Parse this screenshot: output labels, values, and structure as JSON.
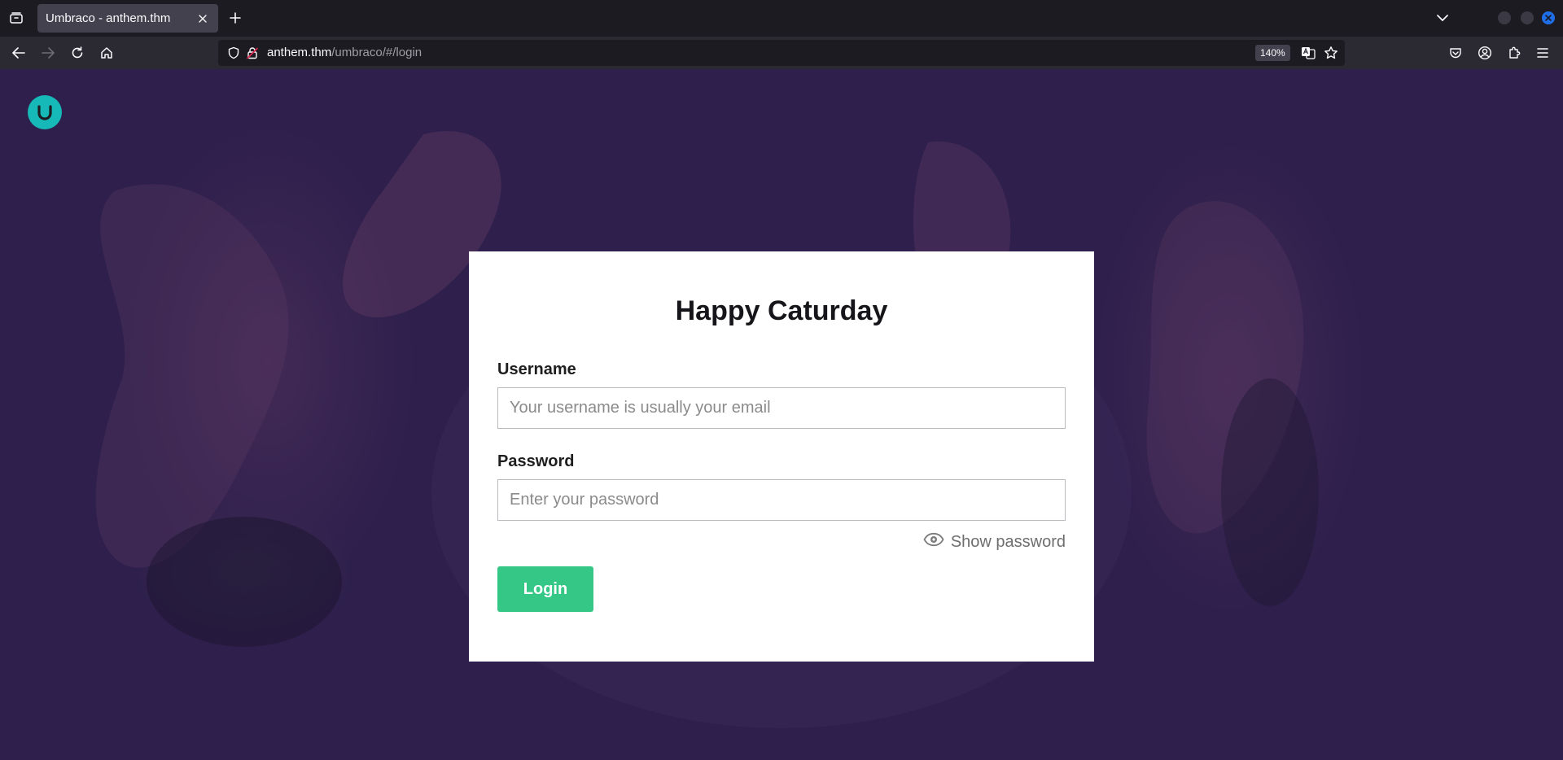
{
  "browser": {
    "tab": {
      "title": "Umbraco - anthem.thm"
    },
    "url": {
      "host": "anthem.thm",
      "path": "/umbraco/#/login"
    },
    "zoom": "140%",
    "accent_color": "#1f6feb"
  },
  "page": {
    "logo": {
      "icon": "umbraco-logo-icon",
      "color": "#16b8b8"
    },
    "login": {
      "heading": "Happy Caturday",
      "username_label": "Username",
      "username_placeholder": "Your username is usually your email",
      "username_value": "",
      "password_label": "Password",
      "password_placeholder": "Enter your password",
      "password_value": "",
      "show_password_label": "Show password",
      "login_button": "Login",
      "button_color": "#35c786"
    }
  }
}
